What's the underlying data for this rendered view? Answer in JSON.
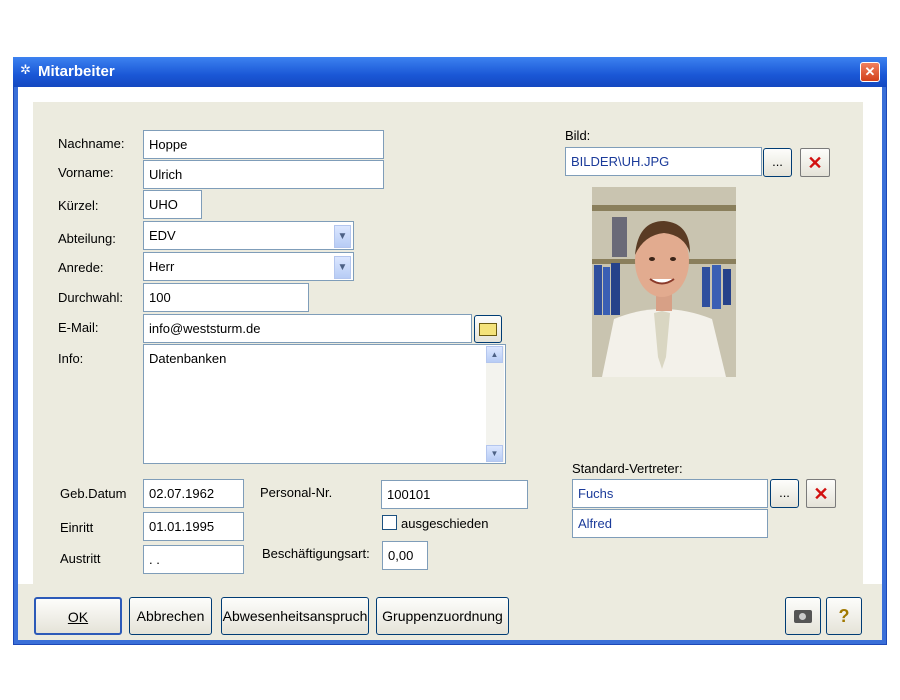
{
  "window": {
    "title": "Mitarbeiter",
    "title_icon": "app-icon",
    "close_label": "✕"
  },
  "form": {
    "nachname": {
      "label": "Nachname:",
      "value": "Hoppe"
    },
    "vorname": {
      "label": "Vorname:",
      "value": "Ulrich"
    },
    "kuerzel": {
      "label": "Kürzel:",
      "value": "UHO"
    },
    "abteilung": {
      "label": "Abteilung:",
      "value": "EDV"
    },
    "anrede": {
      "label": "Anrede:",
      "value": "Herr"
    },
    "durchwahl": {
      "label": "Durchwahl:",
      "value": "100"
    },
    "email": {
      "label": "E-Mail:",
      "value": "info@weststurm.de"
    },
    "info": {
      "label": "Info:",
      "value": "Datenbanken"
    },
    "geb_datum": {
      "label": "Geb.Datum",
      "value": "02.07.1962"
    },
    "eintritt": {
      "label": "Einritt",
      "value": "01.01.1995"
    },
    "austritt": {
      "label": "Austritt",
      "value": " .  ."
    },
    "personal_nr": {
      "label": "Personal-Nr.",
      "value": "100101"
    },
    "ausgeschieden": {
      "label": "ausgeschieden",
      "checked": false
    },
    "beschaeftigungsart": {
      "label": "Beschäftigungsart:",
      "value": "0,00"
    }
  },
  "bild": {
    "label": "Bild:",
    "value": "BILDER\\UH.JPG",
    "browse_label": "...",
    "delete_label": "✕"
  },
  "vertreter": {
    "label": "Standard-Vertreter:",
    "nachname": "Fuchs",
    "vorname": "Alfred",
    "browse_label": "...",
    "delete_label": "✕"
  },
  "buttons": {
    "ok": "OK",
    "abbrechen": "Abbrechen",
    "abwesenheit": "Abwesenheitsanspruch",
    "gruppen": "Gruppenzuordnung",
    "camera_icon": "camera-icon",
    "help_label": "?"
  }
}
